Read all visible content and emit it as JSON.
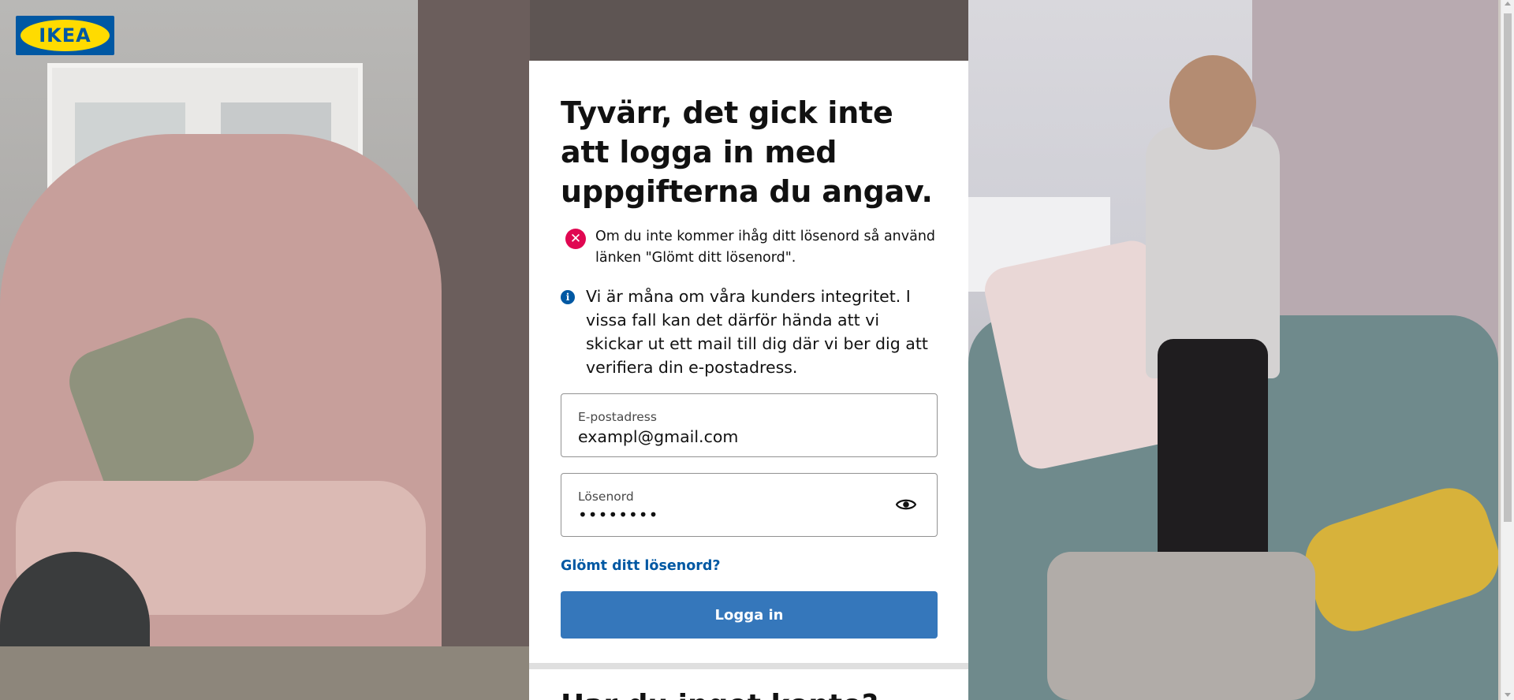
{
  "logo": {
    "text": "IKEA",
    "colors": {
      "blue": "#0058a3",
      "yellow": "#ffdb00"
    }
  },
  "card": {
    "title": "Tyvärr, det gick inte att logga in med uppgifterna du angav.",
    "error": {
      "icon": "close-icon",
      "text": "Om du inte kommer ihåg ditt lösenord så använd länken \"Glömt ditt lösenord\"."
    },
    "info": {
      "icon": "info-icon",
      "text": "Vi är måna om våra kunders integritet. I vissa fall kan det därför hända att vi skickar ut ett mail till dig där vi ber dig att verifiera din e-postadress."
    },
    "email": {
      "label": "E-postadress",
      "value": "exampl@gmail.com"
    },
    "password": {
      "label": "Lösenord",
      "value": "••••••••",
      "toggle_icon": "eye-icon"
    },
    "forgot_link": "Glömt ditt lösenord?",
    "login_button": "Logga in",
    "next_section_heading": "Har du inget konto?"
  },
  "colors": {
    "accent": "#3577bb",
    "link": "#0058a3",
    "error": "#e00751"
  }
}
